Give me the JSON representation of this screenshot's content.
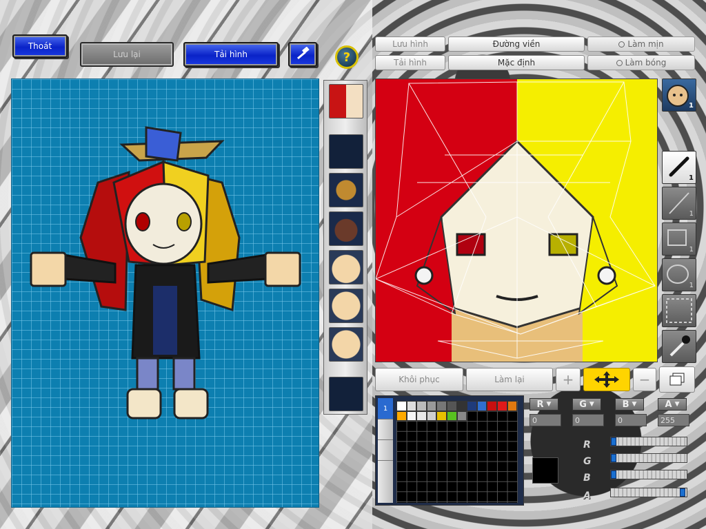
{
  "top_buttons": {
    "exit": "Thoát",
    "save": "Lưu lại",
    "reload": "Tải hình",
    "help": "?"
  },
  "editor_top": {
    "save_image": "Lưu hình",
    "load_image": "Tải hình",
    "outline": "Đường viền",
    "default": "Mặc định",
    "smooth": "Làm mịn",
    "gloss": "Làm bóng"
  },
  "edit_buttons": {
    "restore": "Khôi phục",
    "redo": "Làm lại"
  },
  "tool_counts": {
    "face_preview": "1",
    "pen": "1",
    "line": "1",
    "rect": "1",
    "ellipse": "1"
  },
  "color_channels": {
    "r_label": "R",
    "g_label": "G",
    "b_label": "B",
    "a_label": "A",
    "r_value": "0",
    "g_value": "0",
    "b_value": "0",
    "a_value": "255"
  },
  "slider_levels": {
    "r": 0,
    "g": 0,
    "b": 0,
    "a": 1
  },
  "selected_color": "#000000",
  "palette_colors": [
    "#ffffff",
    "#dddddd",
    "#bbbbbb",
    "#999999",
    "#777777",
    "#555555",
    "#333333",
    "#1f3b7a",
    "#2f6fd0",
    "#c81010",
    "#e01a1a",
    "#e07810",
    "#ffaa00",
    "#f5f5f5",
    "#e8e8e8",
    "#cfcfcf",
    "#e8c000",
    "#58c020",
    "#888888"
  ],
  "palette_tab": "1"
}
